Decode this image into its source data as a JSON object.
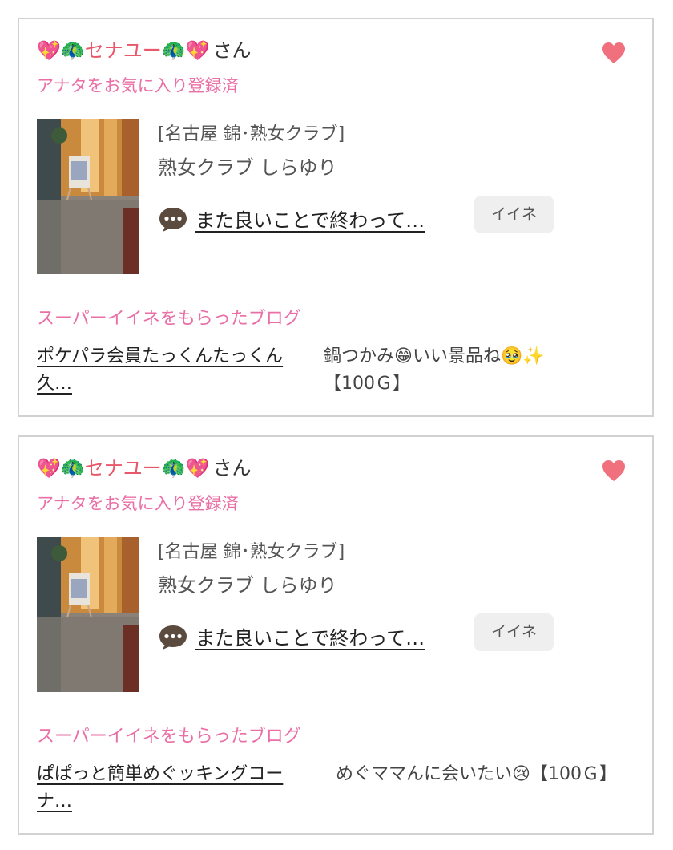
{
  "cards": [
    {
      "name_emoji_left": "💖🦚",
      "user_name": "セナユー",
      "name_emoji_right": "🦚💖",
      "honorific": "さん",
      "favorite_status": "アナタをお気に入り登録済",
      "shop_area": "[名古屋 錦･熟女クラブ]",
      "shop_name": "熟女クラブ しらゆり",
      "comment_preview": "また良いことで終わって…",
      "iine_label": "イイネ",
      "super_iine_heading": "スーパーイイネをもらったブログ",
      "blog_title": "ポケパラ会員たっくんたっくん久…",
      "blog_comment_text": "鍋つかみ",
      "blog_comment_emoji1": "😁",
      "blog_comment_text2": "いい景品ね",
      "blog_comment_emoji2": "🥹✨",
      "blog_comment_reward": "【100Ｇ】"
    },
    {
      "name_emoji_left": "💖🦚",
      "user_name": "セナユー",
      "name_emoji_right": "🦚💖",
      "honorific": "さん",
      "favorite_status": "アナタをお気に入り登録済",
      "shop_area": "[名古屋 錦･熟女クラブ]",
      "shop_name": "熟女クラブ しらゆり",
      "comment_preview": "また良いことで終わって…",
      "iine_label": "イイネ",
      "super_iine_heading": "スーパーイイネをもらったブログ",
      "blog_title": "ぱぱっと簡単めぐッキングコーナ…",
      "blog_comment_text": "めぐママんに会いたい",
      "blog_comment_emoji1": "😢",
      "blog_comment_text2": "",
      "blog_comment_emoji2": "",
      "blog_comment_reward": "【100Ｇ】"
    }
  ],
  "colors": {
    "pink_text": "#ea6fa6",
    "name_red": "#e8576a",
    "heart": "#f0707e",
    "card_border": "#d2d2d2",
    "button_bg": "#efefef"
  },
  "icons": {
    "heart": "heart-icon",
    "bubble": "speech-bubble-icon"
  }
}
